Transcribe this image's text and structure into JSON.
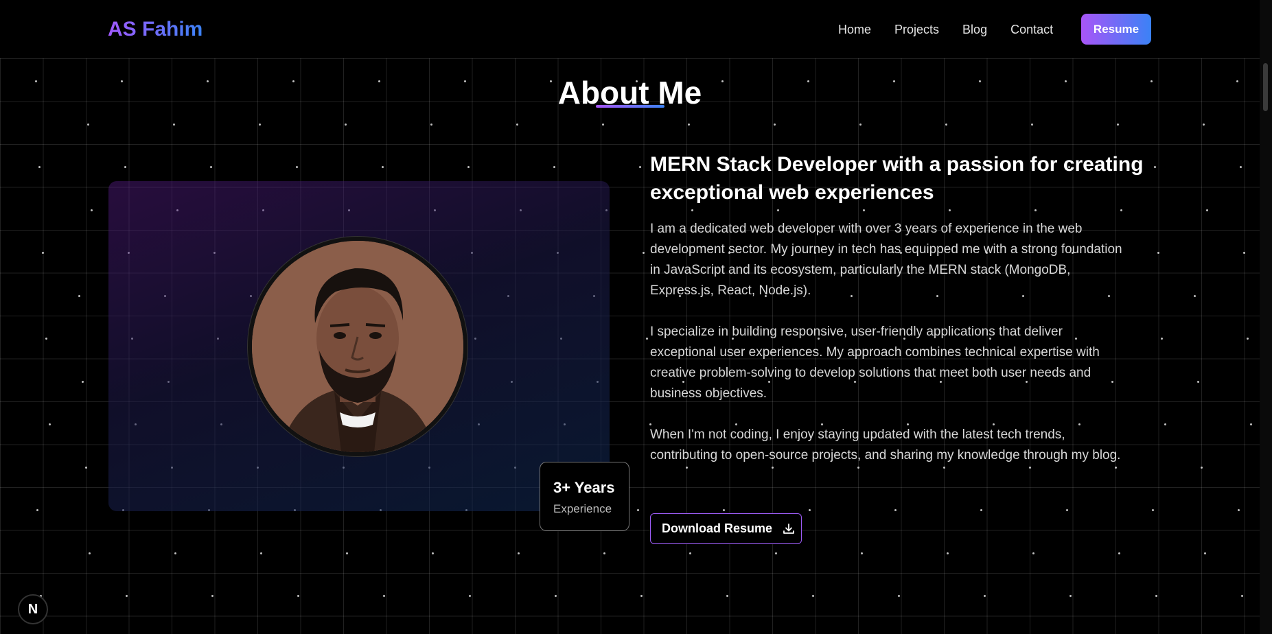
{
  "nav": {
    "logo": "AS Fahim",
    "links": [
      "Home",
      "Projects",
      "Blog",
      "Contact"
    ],
    "resume_label": "Resume"
  },
  "about": {
    "title": "About Me",
    "headline": "MERN Stack Developer with a passion for creating exceptional web experiences",
    "paragraphs": [
      "I am a dedicated web developer with over 3 years of experience in the web development sector. My journey in tech has equipped me with a strong foundation in JavaScript and its ecosystem, particularly the MERN stack (MongoDB, Express.js, React, Node.js).",
      "I specialize in building responsive, user-friendly applications that deliver exceptional user experiences. My approach combines technical expertise with creative problem-solving to develop solutions that meet both user needs and business objectives.",
      "When I'm not coding, I enjoy staying updated with the latest tech trends, contributing to open-source projects, and sharing my knowledge through my blog."
    ],
    "experience_value": "3+ Years",
    "experience_label": "Experience",
    "download_label": "Download Resume"
  },
  "dev_badge": "N",
  "colors": {
    "accent_purple": "#a855f7",
    "accent_blue": "#3b82f6",
    "background": "#000000"
  }
}
